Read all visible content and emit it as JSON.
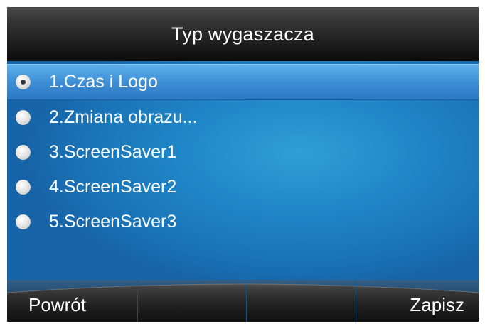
{
  "title": "Typ wygaszacza",
  "options": [
    {
      "label": "1.Czas i Logo",
      "selected": true
    },
    {
      "label": "2.Zmiana obrazu...",
      "selected": false
    },
    {
      "label": "3.ScreenSaver1",
      "selected": false
    },
    {
      "label": "4.ScreenSaver2",
      "selected": false
    },
    {
      "label": "5.ScreenSaver3",
      "selected": false
    }
  ],
  "softkeys": {
    "back_label": "Powrót",
    "key2_label": "",
    "key3_label": "",
    "save_label": "Zapisz"
  },
  "colors": {
    "title_bar": "#1c1c1c",
    "content_bg": "#1f86c6",
    "selected_row": "#3f8fd6",
    "softkey_bar": "#222222"
  }
}
